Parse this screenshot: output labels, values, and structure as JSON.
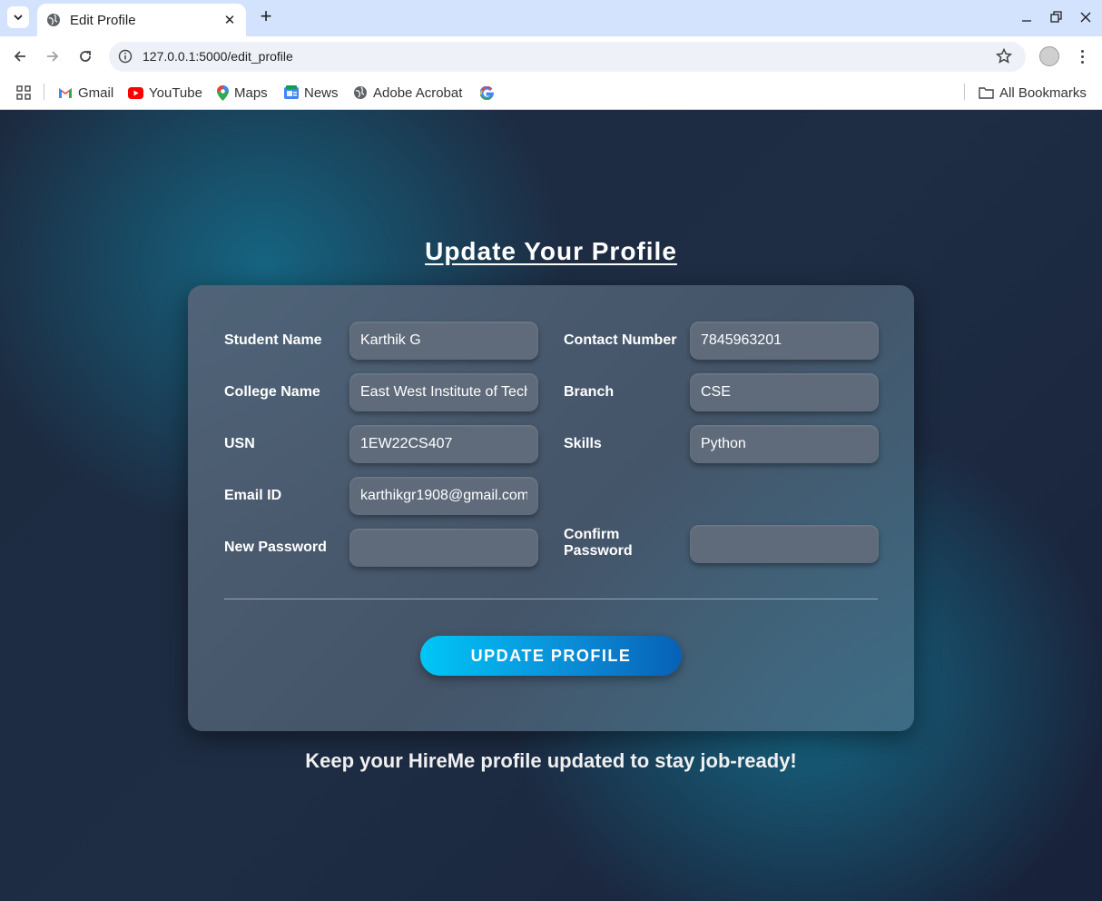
{
  "browser": {
    "tab_title": "Edit Profile",
    "url": "127.0.0.1:5000/edit_profile",
    "bookmarks": [
      {
        "label": "Gmail",
        "icon": "gmail-icon"
      },
      {
        "label": "YouTube",
        "icon": "youtube-icon"
      },
      {
        "label": "Maps",
        "icon": "maps-icon"
      },
      {
        "label": "News",
        "icon": "news-icon"
      },
      {
        "label": "Adobe Acrobat",
        "icon": "globe-icon"
      },
      {
        "label": "",
        "icon": "google-icon"
      }
    ],
    "all_bookmarks_label": "All Bookmarks"
  },
  "page": {
    "title": "Update Your Profile",
    "fields": {
      "student_name": {
        "label": "Student Name",
        "value": "Karthik G"
      },
      "contact_number": {
        "label": "Contact Number",
        "value": "7845963201"
      },
      "college_name": {
        "label": "College Name",
        "value": "East West Institute of Technology"
      },
      "branch": {
        "label": "Branch",
        "value": "CSE"
      },
      "usn": {
        "label": "USN",
        "value": "1EW22CS407"
      },
      "skills": {
        "label": "Skills",
        "value": "Python"
      },
      "email": {
        "label": "Email ID",
        "value": "karthikgr1908@gmail.com"
      },
      "new_password": {
        "label": "New Password",
        "value": ""
      },
      "confirm_password": {
        "label": "Confirm Password",
        "value": ""
      }
    },
    "submit_label": "UPDATE PROFILE",
    "tagline": "Keep your HireMe profile updated to stay job-ready!"
  },
  "colors": {
    "accent_start": "#00c6f7",
    "accent_end": "#0860b6",
    "card_bg": "#54647a",
    "page_bg": "#1a2536"
  }
}
